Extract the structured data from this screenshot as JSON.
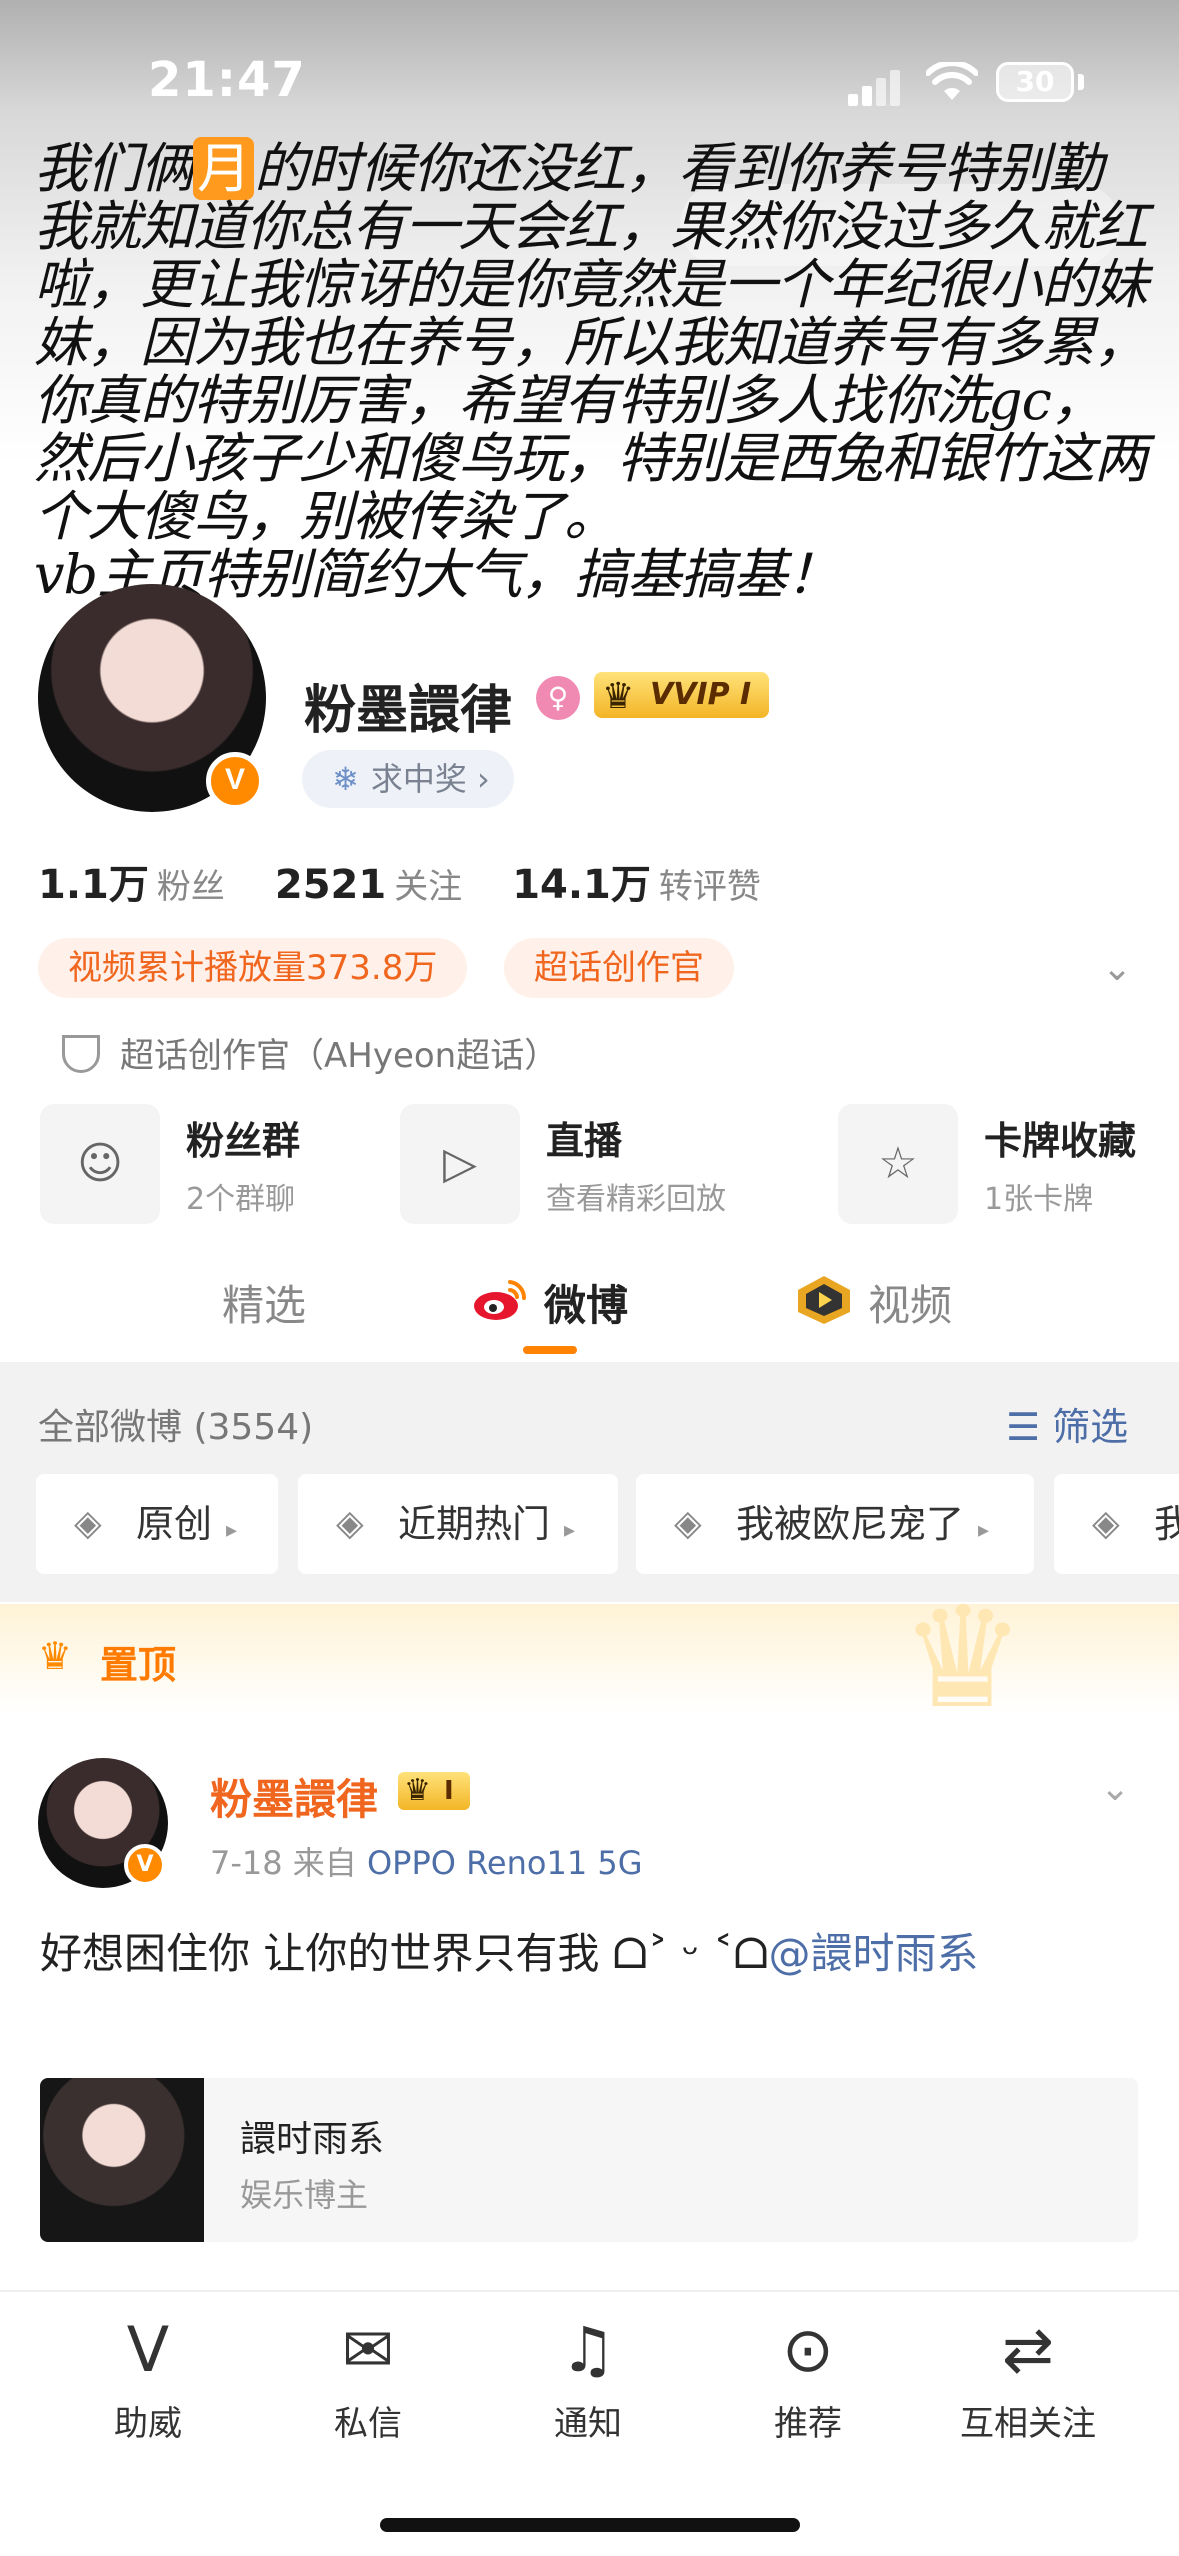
{
  "status_bar": {
    "time": "21:47",
    "battery": "30"
  },
  "note": {
    "before_highlight": "我们俩",
    "highlight": "月",
    "after_highlight": "的时候你还没红，看到你养号特别勤我就知道你总有一天会红，果然你没过多久就红啦，更让我惊讶的是你竟然是一个年纪很小的妹妹，因为我也在养号，所以我知道养号有多累，你真的特别厉害，希望有特别多人找你洗gc，然后小孩子少和傻鸟玩，特别是西兔和银竹这两个大傻鸟，别被传染了。",
    "line_last": "vb主页特别简约大气，搞基搞基！"
  },
  "profile": {
    "username": "粉墨譞律",
    "gender_icon": "female-icon",
    "vip_label": "VVIP I",
    "award_label": "求中奖 ›",
    "stats": [
      {
        "value": "1.1万",
        "label": "粉丝"
      },
      {
        "value": "2521",
        "label": "关注"
      },
      {
        "value": "14.1万",
        "label": "转评赞"
      }
    ],
    "tags": [
      "视频累计播放量373.8万",
      "超话创作官"
    ],
    "creator_text": "超话创作官（AHyeon超话）"
  },
  "feature_cards": [
    {
      "icon": "fans-group-icon",
      "title": "粉丝群",
      "sub": "2个群聊"
    },
    {
      "icon": "live-tv-icon",
      "title": "直播",
      "sub": "查看精彩回放"
    },
    {
      "icon": "card-collection-icon",
      "title": "卡牌收藏",
      "sub": "1张卡牌"
    }
  ],
  "tabs": [
    "精选",
    "微博",
    "视频"
  ],
  "feed_header": {
    "all_label": "全部微博 (3554)",
    "filter_label": "筛选"
  },
  "chips": [
    "原创",
    "近期热门",
    "我被欧尼宠了",
    "我"
  ],
  "pinned_label": "置顶",
  "post": {
    "author": "粉墨譞律",
    "badge": "I",
    "date": "7-18",
    "from_prefix": "来自",
    "device": "OPPO Reno11 5G",
    "text": "好想困住你 让你的世界只有我 ᗝ˃ ᵕ ˂ᗝ",
    "mention": "@譞时雨系",
    "card": {
      "title": "譞时雨系",
      "subtitle": "娱乐博主"
    }
  },
  "bottom_nav": [
    {
      "icon": "boost-icon",
      "label": "助威"
    },
    {
      "icon": "message-icon",
      "label": "私信"
    },
    {
      "icon": "bell-icon",
      "label": "通知"
    },
    {
      "icon": "recommend-icon",
      "label": "推荐"
    },
    {
      "icon": "mutual-follow-icon",
      "label": "互相关注"
    }
  ],
  "colors": {
    "accent": "#ff8200",
    "link": "#4e6ea8",
    "tag_text": "#f0661e"
  }
}
